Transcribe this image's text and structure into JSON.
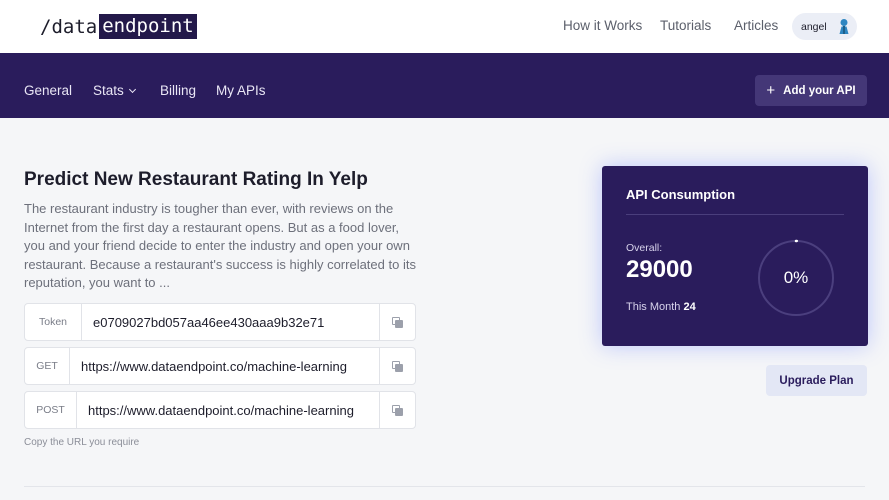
{
  "header": {
    "logo_prefix": "/data",
    "logo_highlight": "endpoint",
    "nav": [
      "How it Works",
      "Tutorials",
      "Articles"
    ],
    "user": "angel"
  },
  "subnav": {
    "items": [
      "General",
      "Stats",
      "Billing",
      "My APIs"
    ],
    "add_api_label": "Add your API"
  },
  "api": {
    "title": "Predict New Restaurant Rating In Yelp",
    "description": "The restaurant industry is tougher than ever, with reviews on the Internet from the first day a restaurant opens. But as a food lover, you and your friend decide to enter the industry and open your own restaurant. Because a restaurant's success is highly correlated to its reputation, you want to ...",
    "fields": [
      {
        "label": "Token",
        "value": "e0709027bd057aa46ee430aaa9b32e71"
      },
      {
        "label": "GET",
        "value": "https://www.dataendpoint.co/machine-learning"
      },
      {
        "label": "POST",
        "value": "https://www.dataendpoint.co/machine-learning"
      }
    ],
    "hint": "Copy the URL you require"
  },
  "consumption": {
    "title": "API Consumption",
    "overall_label": "Overall:",
    "overall_value": "29000",
    "month_label": "This Month",
    "month_value": "24",
    "percent_text": "0%",
    "percent": 0
  },
  "upgrade_label": "Upgrade Plan",
  "colors": {
    "brand_purple": "#2a1c5c",
    "button_purple": "#443777",
    "upgrade_bg": "#e3e7f5",
    "avatar_blue": "#2e86c1"
  },
  "icons": [
    "plus-icon",
    "chevron-down-icon",
    "copy-icon",
    "avatar-icon"
  ]
}
